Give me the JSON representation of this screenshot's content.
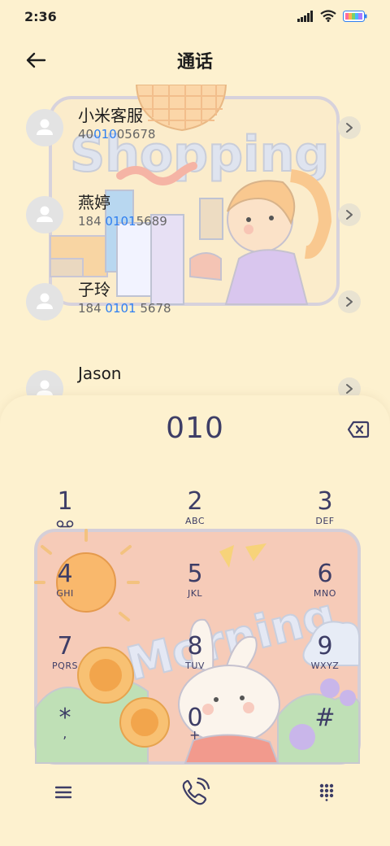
{
  "status": {
    "time": "2:36",
    "icons": [
      "signal-icon",
      "wifi-icon",
      "battery-icon"
    ]
  },
  "header": {
    "title": "通话",
    "back_icon": "back-arrow-icon"
  },
  "contacts": [
    {
      "name": "小米客服",
      "number_pre": "40",
      "number_hl": "010",
      "number_post": "05678"
    },
    {
      "name": "燕婷",
      "number_pre": "184 ",
      "number_hl": "0101",
      "number_post": "5689"
    },
    {
      "name": "子玲",
      "number_pre": "184 ",
      "number_hl": "0101",
      "number_post": " 5678"
    },
    {
      "name": "Jason",
      "number_pre": "",
      "number_hl": "",
      "number_post": ""
    }
  ],
  "illustrations": {
    "top_text": "Shopping",
    "bottom_text": "Morning"
  },
  "dialpad": {
    "entered": "010",
    "delete_icon": "backspace-icon",
    "keys": [
      {
        "digit": "1",
        "letters": ""
      },
      {
        "digit": "2",
        "letters": "ABC"
      },
      {
        "digit": "3",
        "letters": "DEF"
      },
      {
        "digit": "4",
        "letters": "GHI"
      },
      {
        "digit": "5",
        "letters": "JKL"
      },
      {
        "digit": "6",
        "letters": "MNO"
      },
      {
        "digit": "7",
        "letters": "PQRS"
      },
      {
        "digit": "8",
        "letters": "TUV"
      },
      {
        "digit": "9",
        "letters": "WXYZ"
      },
      {
        "digit": "*",
        "letters": ","
      },
      {
        "digit": "0",
        "letters": "+"
      },
      {
        "digit": "#",
        "letters": ""
      }
    ]
  },
  "bottom_bar": {
    "icons": [
      "menu-icon",
      "call-icon",
      "dialpad-toggle-icon"
    ]
  },
  "colors": {
    "background": "#fdf1cf",
    "accent": "#2f7ff0",
    "digit": "#3d3d66"
  }
}
